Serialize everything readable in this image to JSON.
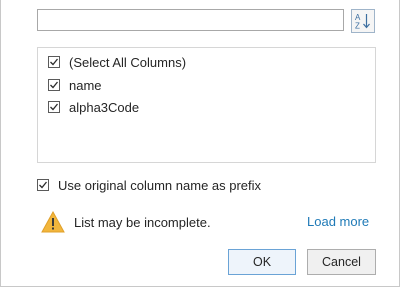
{
  "search": {
    "value": "",
    "placeholder": ""
  },
  "sort_button": {
    "icon": "sort-az-icon",
    "letter_top": "A",
    "letter_bottom": "Z"
  },
  "columns_list": {
    "items": [
      {
        "label": "(Select All Columns)",
        "checked": true
      },
      {
        "label": "name",
        "checked": true
      },
      {
        "label": "alpha3Code",
        "checked": true
      }
    ]
  },
  "prefix_option": {
    "label": "Use original column name as prefix",
    "checked": true
  },
  "warning": {
    "icon": "warning-icon",
    "text": "List may be incomplete.",
    "link": "Load more"
  },
  "buttons": {
    "ok": "OK",
    "cancel": "Cancel"
  },
  "colors": {
    "accent": "#1f7ab7",
    "warning": "#f2b63c"
  }
}
